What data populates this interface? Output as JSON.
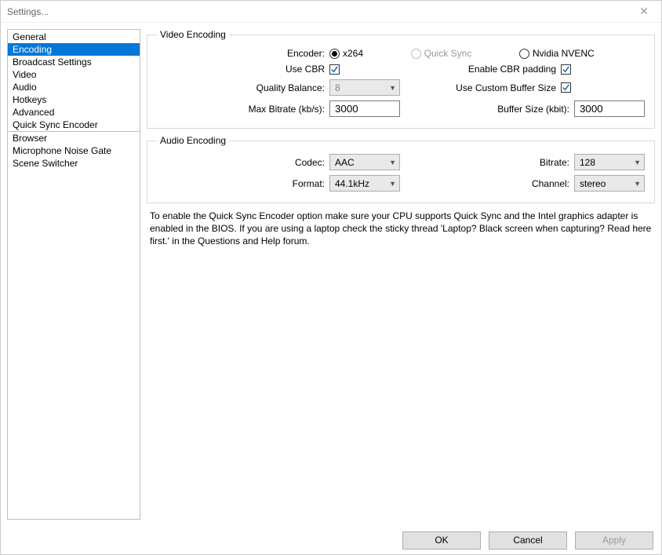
{
  "window": {
    "title": "Settings..."
  },
  "sidebar": {
    "items": [
      "General",
      "Encoding",
      "Broadcast Settings",
      "Video",
      "Audio",
      "Hotkeys",
      "Advanced",
      "Quick Sync Encoder",
      "Browser",
      "Microphone Noise Gate",
      "Scene Switcher"
    ],
    "selected_index": 1,
    "separator_after_index": 7
  },
  "video_encoding": {
    "legend": "Video Encoding",
    "encoder_label": "Encoder:",
    "encoder_options": {
      "x264": "x264",
      "quicksync": "Quick Sync",
      "nvenc": "Nvidia NVENC"
    },
    "encoder_selected": "x264",
    "quicksync_disabled": true,
    "use_cbr_label": "Use CBR",
    "use_cbr_checked": true,
    "enable_cbr_padding_label": "Enable CBR padding",
    "enable_cbr_padding_checked": true,
    "quality_balance_label": "Quality Balance:",
    "quality_balance_value": "8",
    "quality_balance_disabled": true,
    "use_custom_buffer_label": "Use Custom Buffer Size",
    "use_custom_buffer_checked": true,
    "max_bitrate_label": "Max Bitrate (kb/s):",
    "max_bitrate_value": "3000",
    "buffer_size_label": "Buffer Size (kbit):",
    "buffer_size_value": "3000"
  },
  "audio_encoding": {
    "legend": "Audio Encoding",
    "codec_label": "Codec:",
    "codec_value": "AAC",
    "bitrate_label": "Bitrate:",
    "bitrate_value": "128",
    "format_label": "Format:",
    "format_value": "44.1kHz",
    "channel_label": "Channel:",
    "channel_value": "stereo"
  },
  "info_text": "To enable the Quick Sync Encoder option make sure your CPU supports Quick Sync and the Intel graphics adapter is enabled in the BIOS. If you are using a laptop check the sticky thread 'Laptop? Black screen when capturing? Read here first.' in the Questions and Help forum.",
  "footer": {
    "ok": "OK",
    "cancel": "Cancel",
    "apply": "Apply"
  }
}
